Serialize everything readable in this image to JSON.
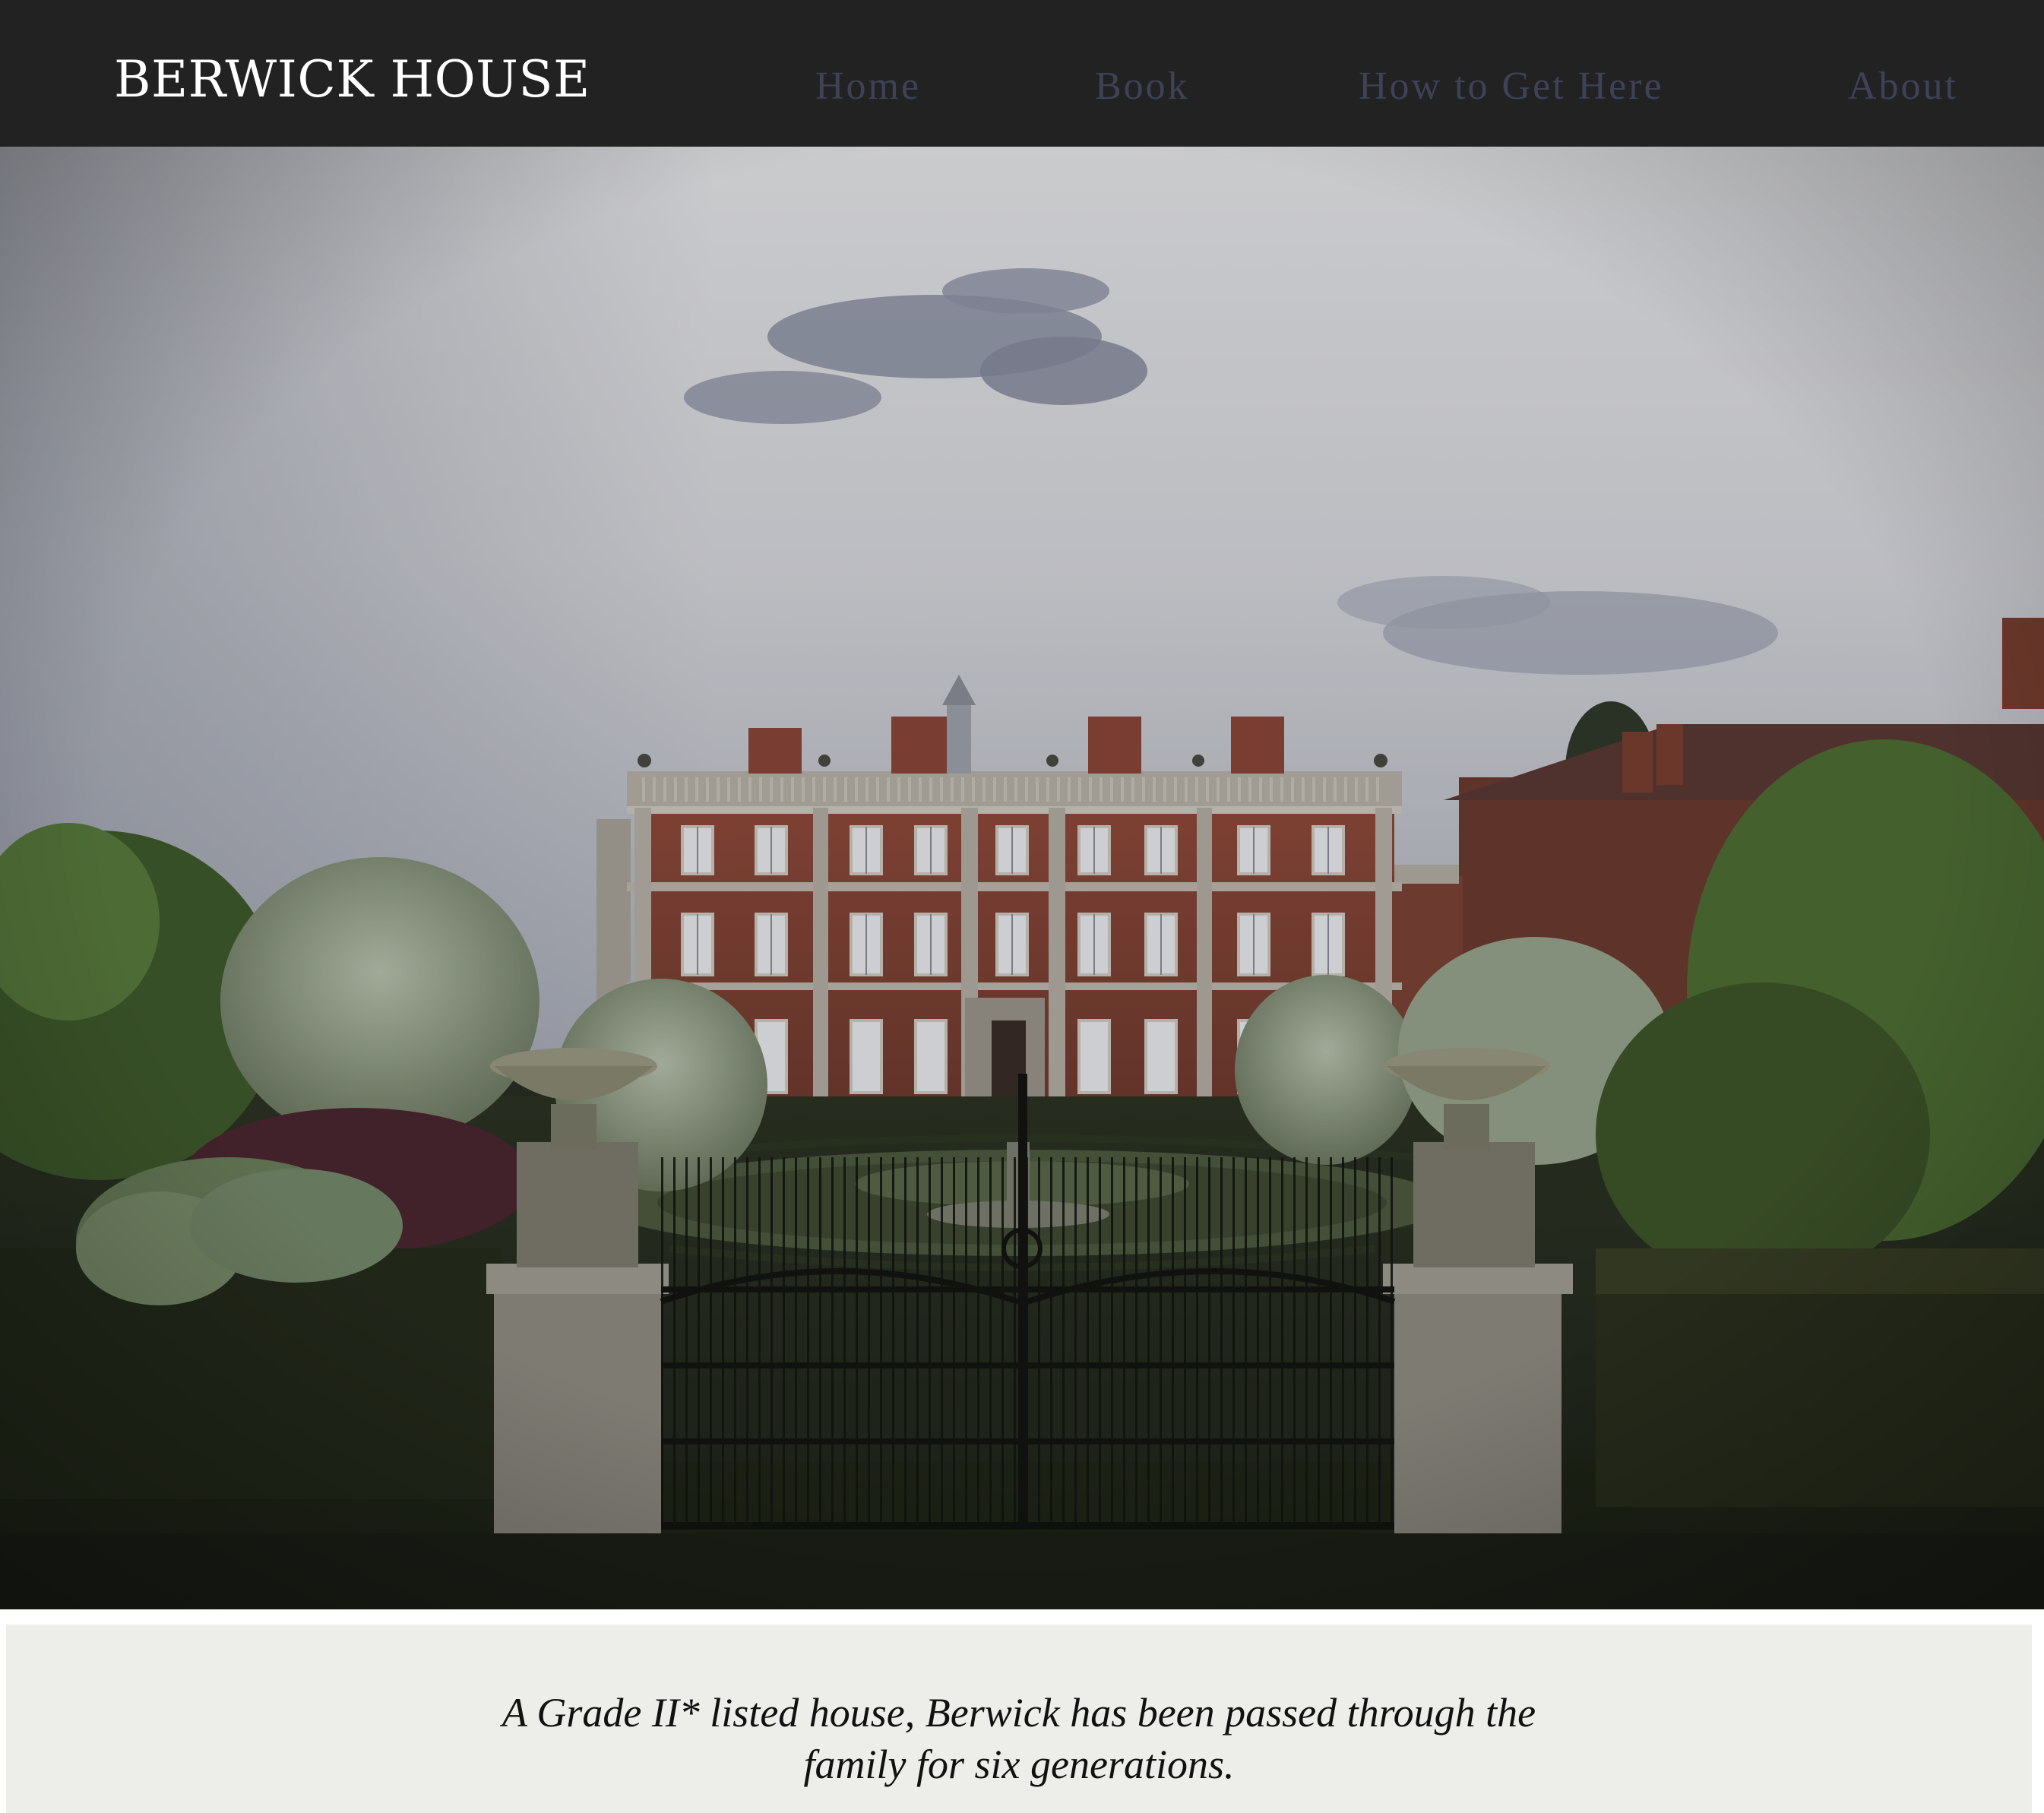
{
  "header": {
    "brand": "BERWICK HOUSE",
    "nav": {
      "home": "Home",
      "book": "Book",
      "how_to_get_here": "How to Get Here",
      "about": "About"
    }
  },
  "hero": {
    "image_description_icon": "house-photo"
  },
  "intro": {
    "line1": "A Grade II* listed house, Berwick has been passed through the",
    "line2": "family for six generations."
  },
  "colors": {
    "header_bg": "#222223",
    "nav_text": "#3d4257",
    "brand_text": "#ffffff",
    "panel_bg": "#ededea"
  }
}
